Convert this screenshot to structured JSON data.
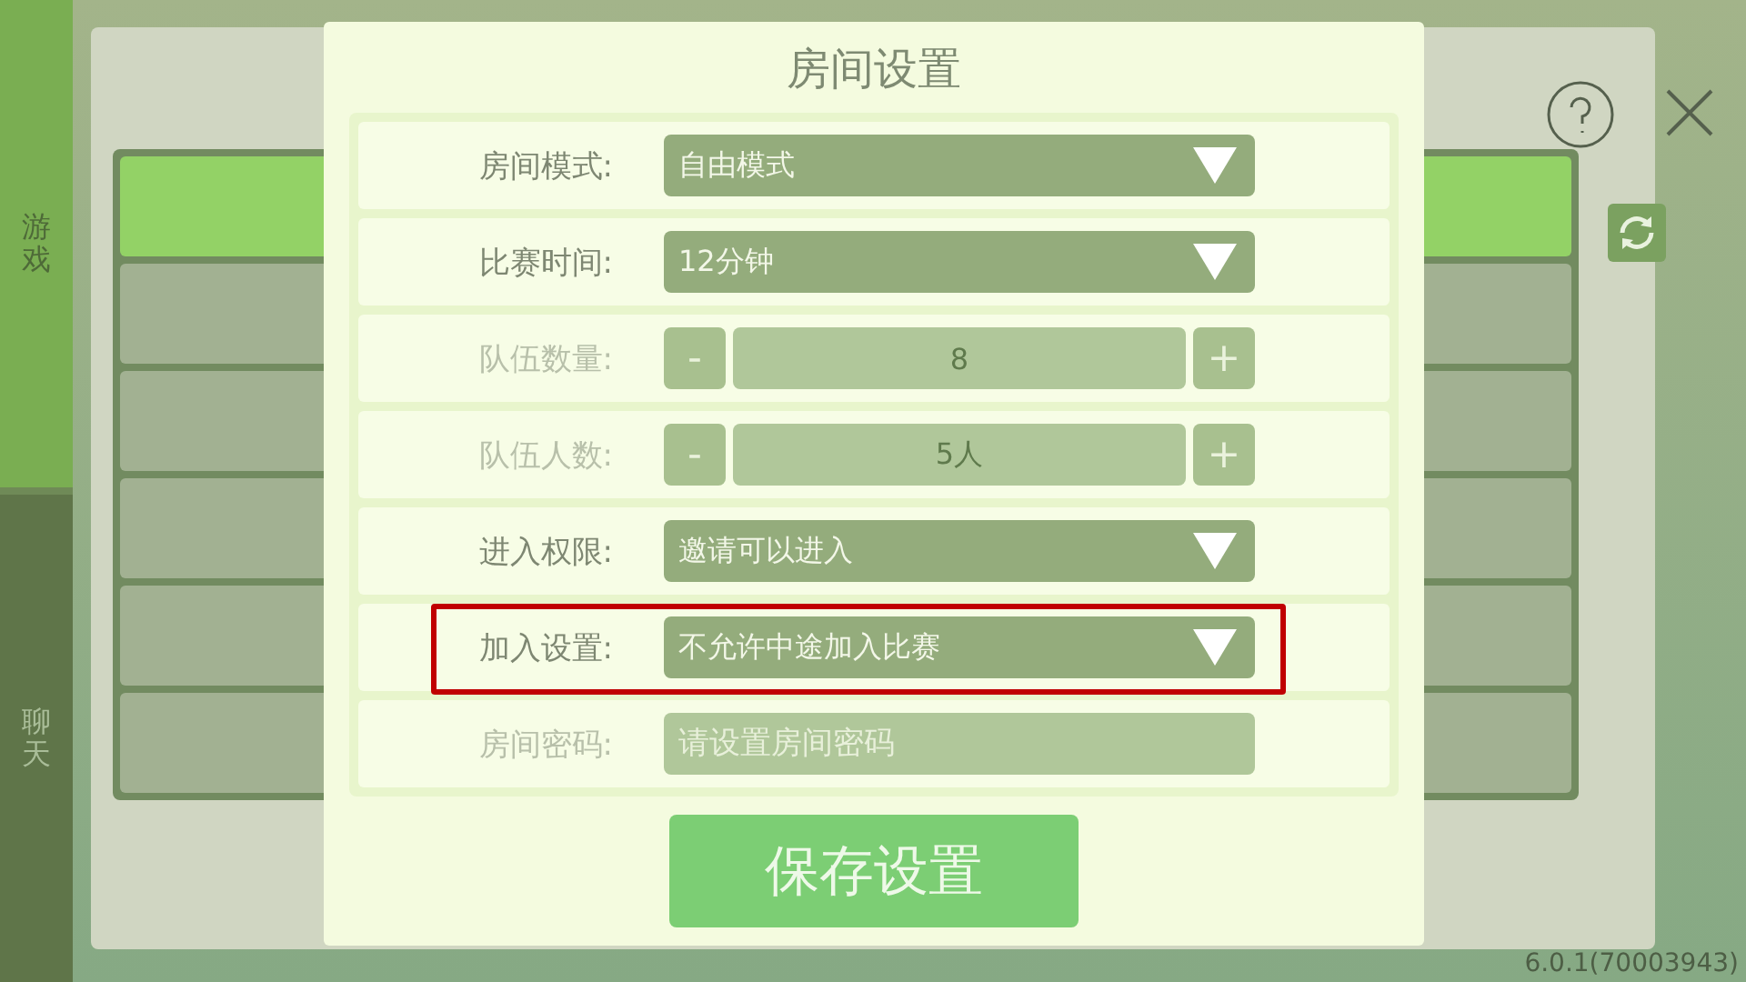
{
  "sidebar": {
    "tabs": [
      {
        "label": "游戏",
        "selected": true
      },
      {
        "label": "聊天",
        "selected": false
      }
    ]
  },
  "dialog": {
    "title": "房间设置",
    "rows": [
      {
        "kind": "dropdown",
        "label": "房间模式:",
        "value": "自由模式",
        "disabled": false,
        "highlighted": false
      },
      {
        "kind": "dropdown",
        "label": "比赛时间:",
        "value": "12分钟",
        "disabled": false,
        "highlighted": false
      },
      {
        "kind": "stepper",
        "label": "队伍数量:",
        "value": "8",
        "minus": "-",
        "plus": "+",
        "disabled": true,
        "highlighted": false
      },
      {
        "kind": "stepper",
        "label": "队伍人数:",
        "value": "5人",
        "minus": "-",
        "plus": "+",
        "disabled": true,
        "highlighted": false
      },
      {
        "kind": "dropdown",
        "label": "进入权限:",
        "value": "邀请可以进入",
        "disabled": false,
        "highlighted": false
      },
      {
        "kind": "dropdown",
        "label": "加入设置:",
        "value": "不允许中途加入比赛",
        "disabled": false,
        "highlighted": true
      },
      {
        "kind": "input",
        "label": "房间密码:",
        "placeholder": "请设置房间密码",
        "disabled": true,
        "highlighted": false
      }
    ],
    "save_button": "保存设置"
  },
  "room_list": {
    "rows": [
      {
        "selected": true
      },
      {
        "selected": false
      },
      {
        "selected": false
      },
      {
        "selected": false
      },
      {
        "selected": false
      },
      {
        "selected": false
      }
    ]
  },
  "version": "6.0.1(70003943)"
}
